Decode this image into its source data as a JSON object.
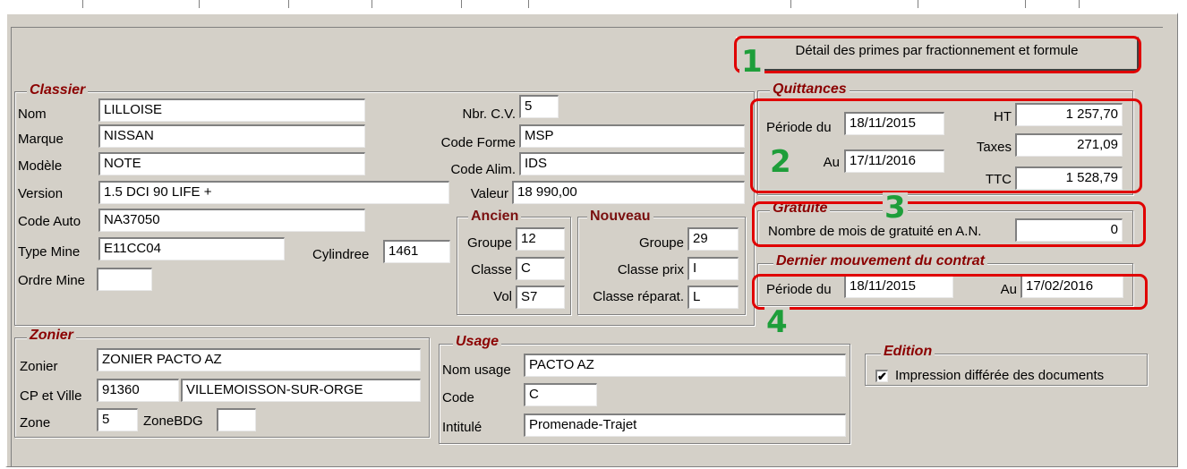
{
  "header": {
    "detail_button": "Détail des primes par fractionnement et formule"
  },
  "badges": [
    "1",
    "2",
    "3",
    "4"
  ],
  "classier": {
    "legend": "Classier",
    "nom": {
      "label": "Nom",
      "value": "LILLOISE"
    },
    "marque": {
      "label": "Marque",
      "value": "NISSAN"
    },
    "modele": {
      "label": "Modèle",
      "value": "NOTE"
    },
    "version": {
      "label": "Version",
      "value": "1.5 DCI 90 LIFE +"
    },
    "code_auto": {
      "label": "Code Auto",
      "value": "NA37050"
    },
    "type_mine": {
      "label": "Type Mine",
      "value": "E11CC04"
    },
    "ordre_mine": {
      "label": "Ordre Mine",
      "value": ""
    },
    "cylindree": {
      "label": "Cylindree",
      "value": "1461"
    },
    "nbr_cv": {
      "label": "Nbr. C.V.",
      "value": "5"
    },
    "code_forme": {
      "label": "Code Forme",
      "value": "MSP"
    },
    "code_alim": {
      "label": "Code Alim.",
      "value": "IDS"
    },
    "valeur": {
      "label": "Valeur",
      "value": "18 990,00"
    },
    "ancien": {
      "legend": "Ancien",
      "groupe": {
        "label": "Groupe",
        "value": "12"
      },
      "classe": {
        "label": "Classe",
        "value": "C"
      },
      "vol": {
        "label": "Vol",
        "value": "S7"
      }
    },
    "nouveau": {
      "legend": "Nouveau",
      "groupe": {
        "label": "Groupe",
        "value": "29"
      },
      "classe_prix": {
        "label": "Classe prix",
        "value": "I"
      },
      "classe_reparat": {
        "label": "Classe réparat.",
        "value": "L"
      }
    }
  },
  "quittances": {
    "legend": "Quittances",
    "periode_du": {
      "label": "Période du",
      "value": "18/11/2015"
    },
    "au": {
      "label": "Au",
      "value": "17/11/2016"
    },
    "ht": {
      "label": "HT",
      "value": "1 257,70"
    },
    "taxes": {
      "label": "Taxes",
      "value": "271,09"
    },
    "ttc": {
      "label": "TTC",
      "value": "1 528,79"
    }
  },
  "gratuite": {
    "legend": "Gratuité",
    "nb_mois": {
      "label": "Nombre de mois de gratuité en A.N.",
      "value": "0"
    }
  },
  "dernier_mouvement": {
    "legend": "Dernier mouvement du contrat",
    "periode_du": {
      "label": "Période du",
      "value": "18/11/2015"
    },
    "au": {
      "label": "Au",
      "value": "17/02/2016"
    }
  },
  "zonier": {
    "legend": "Zonier",
    "zonier": {
      "label": "Zonier",
      "value": "ZONIER PACTO AZ"
    },
    "cp_ville": {
      "label": "CP et Ville",
      "cp": "91360",
      "ville": "VILLEMOISSON-SUR-ORGE"
    },
    "zone": {
      "label": "Zone",
      "value": "5"
    },
    "zonebdg": {
      "label": "ZoneBDG",
      "value": ""
    }
  },
  "usage": {
    "legend": "Usage",
    "nom_usage": {
      "label": "Nom usage",
      "value": "PACTO AZ"
    },
    "code": {
      "label": "Code",
      "value": "C"
    },
    "intitule": {
      "label": "Intitulé",
      "value": "Promenade-Trajet"
    }
  },
  "edition": {
    "legend": "Edition",
    "impression": {
      "label": "Impression différée des documents",
      "checked": true,
      "mark": "✔"
    }
  },
  "colors": {
    "highlight": "#e00000",
    "badge": "#1e9e3a",
    "panel": "#d4d0c8",
    "legend": "#8b0000"
  }
}
